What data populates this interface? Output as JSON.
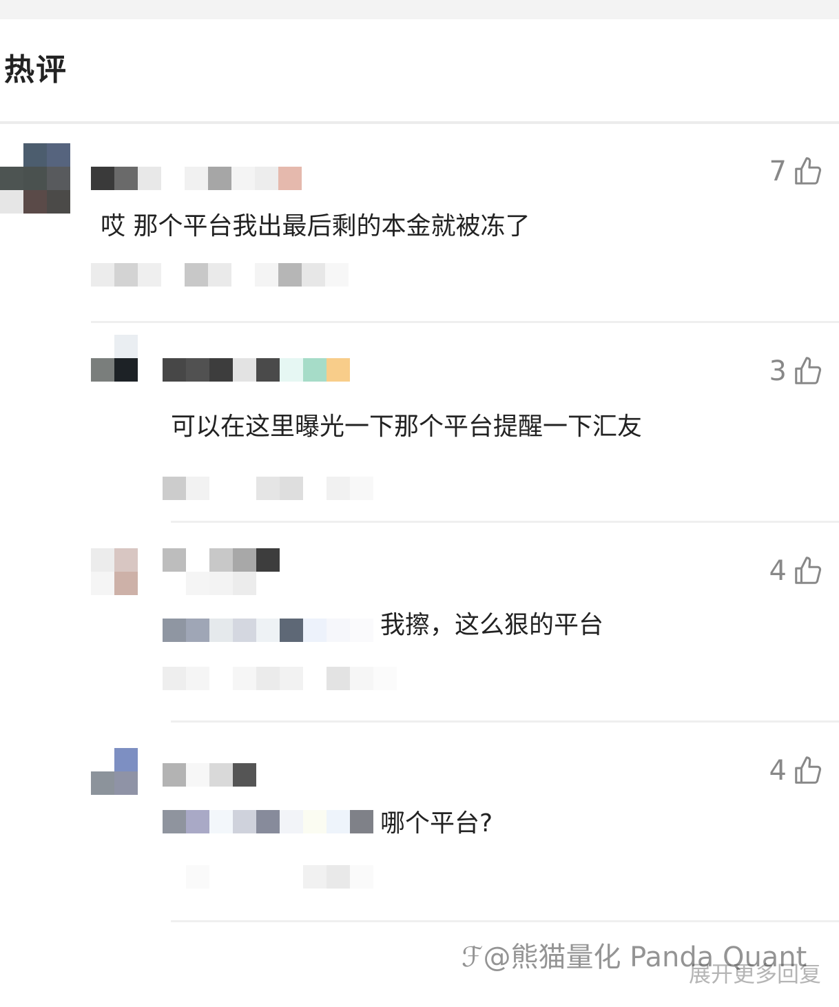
{
  "header": {
    "title": "热评"
  },
  "comments": [
    {
      "text": "哎 那个平台我出最后剩的本金就被冻了",
      "likes": "7"
    },
    {
      "text": "可以在这里曝光一下那个平台提醒一下汇友",
      "likes": "3"
    },
    {
      "text": "我擦，这么狠的平台",
      "likes": "4"
    },
    {
      "text": "哪个平台?",
      "likes": "4"
    }
  ],
  "footer": {
    "more_label": "展开更多回复"
  },
  "watermark": {
    "text": "@熊猫量化 Panda Quant"
  },
  "colors": {
    "text": "#222222",
    "muted": "#888888",
    "divider": "#efefef",
    "header_bar": "#f3f3f3"
  },
  "icons": {
    "like": "thumbs-up-icon",
    "watermark_logo": "logo-icon"
  }
}
